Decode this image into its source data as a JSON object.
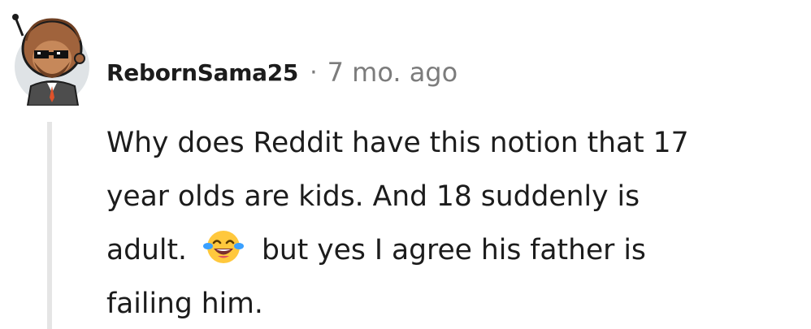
{
  "comment": {
    "author": "RebornSama25",
    "separator": "·",
    "timestamp": "7 mo. ago",
    "body": {
      "line1": "Why does Reddit have this notion that 17",
      "line2": "year olds are kids. And 18 suddenly is",
      "line3_before_emoji": "adult.",
      "emoji": "rolling-on-floor-laughing",
      "line3_after_emoji": "but yes I agree his father is",
      "line4": "failing him."
    }
  },
  "colors": {
    "text": "#1c1c1c",
    "meta": "#7c7c7c",
    "thread_line": "#e5e5e5",
    "avatar_bg": "#dfe3e6"
  }
}
